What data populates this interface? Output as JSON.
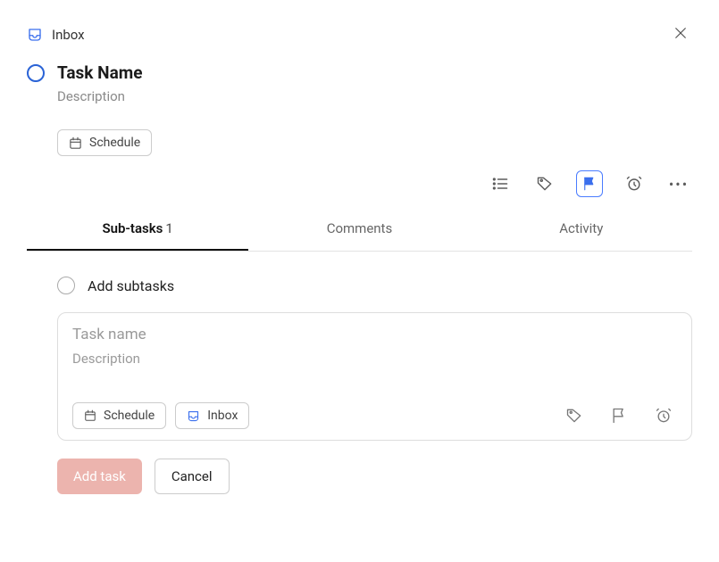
{
  "breadcrumb": {
    "project": "Inbox"
  },
  "task": {
    "title": "Task Name",
    "description": "Description",
    "schedule_label": "Schedule"
  },
  "tabs": {
    "subtasks_label": "Sub-tasks",
    "subtasks_count": "1",
    "comments_label": "Comments",
    "activity_label": "Activity"
  },
  "subtask": {
    "existing_label": "Add subtasks",
    "editor": {
      "name_placeholder": "Task name",
      "desc_placeholder": "Description",
      "schedule_label": "Schedule",
      "project_label": "Inbox"
    },
    "add_btn": "Add task",
    "cancel_btn": "Cancel"
  }
}
